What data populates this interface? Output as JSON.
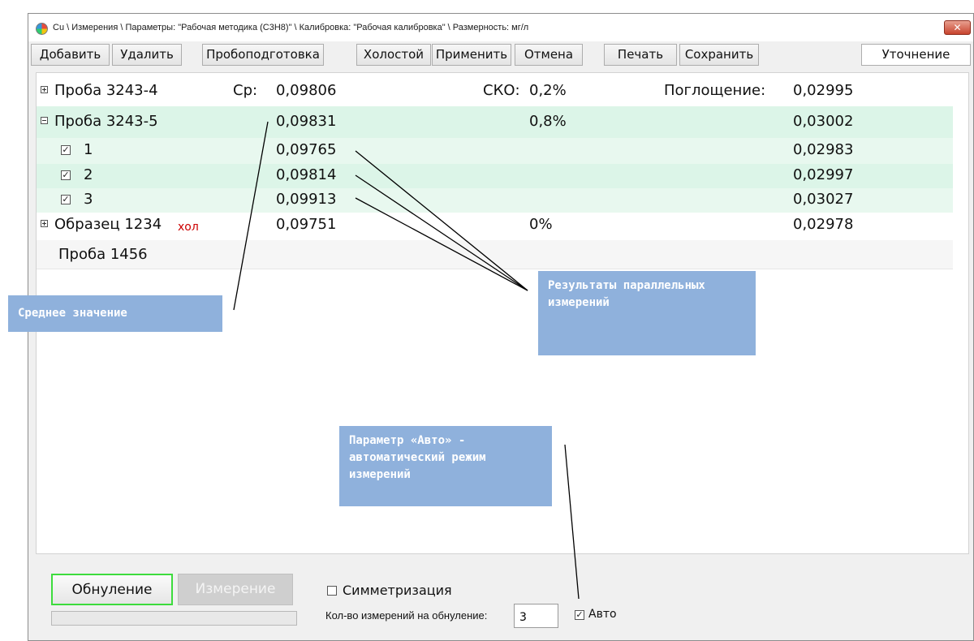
{
  "window": {
    "title": "Cu \\ Измерения \\ Параметры: \"Рабочая методика (C3H8)\" \\ Калибровка: \"Рабочая калибровка\" \\ Размерность: мг/л",
    "close_glyph": "✕"
  },
  "toolbar": {
    "add": "Добавить",
    "delete": "Удалить",
    "sample_prep": "Пробоподготовка",
    "blank": "Холостой",
    "apply": "Применить",
    "cancel": "Отмена",
    "print": "Печать",
    "save": "Сохранить",
    "refine": "Уточнение"
  },
  "rows": [
    {
      "name": "Проба 3243-4",
      "avg_label": "Ср:",
      "mean": "0,09806",
      "sko_label": "СКО:",
      "sko": "0,2%",
      "abs_label": "Поглощение:",
      "absorb": "0,02995"
    },
    {
      "name": "Проба 3243-5",
      "mean": "0,09831",
      "sko": "0,8%",
      "absorb": "0,03002"
    },
    {
      "name": "1",
      "mean": "0,09765",
      "absorb": "0,02983"
    },
    {
      "name": "2",
      "mean": "0,09814",
      "absorb": "0,02997"
    },
    {
      "name": "3",
      "mean": "0,09913",
      "absorb": "0,03027"
    },
    {
      "name": "Образец 1234",
      "tag": "хол",
      "mean": "0,09751",
      "sko": "0%",
      "absorb": "0,02978"
    },
    {
      "name": "Проба 1456"
    }
  ],
  "callouts": {
    "mean": "Среднее значение",
    "parallel": "Результаты параллельных измерений",
    "auto": "Параметр «Авто» - автоматический режим измерений"
  },
  "bottom": {
    "zero_button": "Обнуление",
    "measure_button": "Измерение",
    "symmetrize_label": "Симметризация",
    "count_label": "Кол-во измерений на обнуление:",
    "count_value": "3",
    "auto_label": "Авто"
  },
  "colors": {
    "selected_row": "#dcf5e8",
    "child_row_a": "#e8f8ef",
    "child_row_b": "#dcf5e8",
    "callout_bg": "#8fb1dc",
    "blank_tag": "#cc0000",
    "zero_button_border": "#3ddc3d"
  }
}
